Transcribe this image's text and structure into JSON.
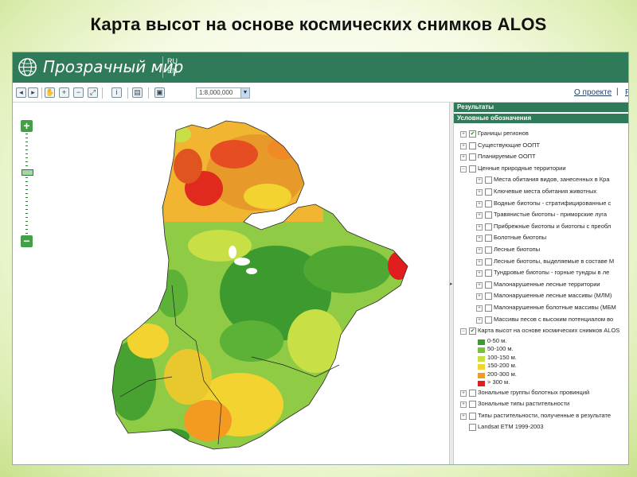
{
  "slide_title": "Карта высот на основе космических снимков ALOS",
  "header": {
    "logo_text": "Прозрачный мир",
    "lang_ru": "RU",
    "lang_en": "EN"
  },
  "toolbar": {
    "scale_value": "1:8,000,000",
    "about_link": "О проекте",
    "separator": "|",
    "truncated_link": "Р",
    "icons": [
      "back-icon",
      "forward-icon",
      "pan-icon",
      "zoom-in-icon",
      "zoom-out-icon",
      "zoom-extent-icon",
      "info-icon",
      "print-icon",
      "save-icon"
    ]
  },
  "map": {
    "zoom_in": "+",
    "zoom_out": "−"
  },
  "panel": {
    "results_title": "Результаты",
    "legend_title": "Условные обозначения",
    "layers": [
      {
        "label": "Границы регионов",
        "level": 0,
        "checked": true
      },
      {
        "label": "Существующие ООПТ",
        "level": 0,
        "checked": false
      },
      {
        "label": "Планируемые ООПТ",
        "level": 0,
        "checked": false
      },
      {
        "label": "Ценные природные территории",
        "level": 0,
        "checked": false,
        "expanded": true
      },
      {
        "label": "Места обитания видов, занесенных в Кра",
        "level": 1,
        "checked": false
      },
      {
        "label": "Ключевые места обитания животных",
        "level": 1,
        "checked": false
      },
      {
        "label": "Водные биотопы - стратифицированные с",
        "level": 1,
        "checked": false
      },
      {
        "label": "Травянистые биотопы - приморские луга",
        "level": 1,
        "checked": false
      },
      {
        "label": "Прибрежные биотопы и биотопы с преобл",
        "level": 1,
        "checked": false
      },
      {
        "label": "Болотные биотопы",
        "level": 1,
        "checked": false
      },
      {
        "label": "Лесные биотопы",
        "level": 1,
        "checked": false
      },
      {
        "label": "Лесные биотопы, выделяемые в составе М",
        "level": 1,
        "checked": false
      },
      {
        "label": "Тундровые биотопы - горные тундры в ле",
        "level": 1,
        "checked": false
      },
      {
        "label": "Малонарушенные лесные территории",
        "level": 1,
        "checked": false
      },
      {
        "label": "Малонарушенные лесные массивы (МЛМ)",
        "level": 1,
        "checked": false
      },
      {
        "label": "Малонарушенные болотные массивы (МБМ",
        "level": 1,
        "checked": false
      },
      {
        "label": "Массивы песов с высоким потенциалом во",
        "level": 1,
        "checked": false
      },
      {
        "label": "Карта высот на основе космических снимков ALOS",
        "level": 0,
        "checked": true,
        "expanded": true
      }
    ],
    "elevation_legend": [
      {
        "label": "0-50 м.",
        "color": "#3c9a2e"
      },
      {
        "label": "50-100 м.",
        "color": "#7cc13a"
      },
      {
        "label": "100-150 м.",
        "color": "#c8e046"
      },
      {
        "label": "150-200 м.",
        "color": "#f3d330"
      },
      {
        "label": "200-300 м.",
        "color": "#f29a22"
      },
      {
        "label": "> 300 м.",
        "color": "#e01e1e"
      }
    ],
    "layers_after": [
      {
        "label": "Зональные группы болотных провинций",
        "level": 0,
        "checked": false
      },
      {
        "label": "Зональные типы растительности",
        "level": 0,
        "checked": false
      },
      {
        "label": "Типы растительности, полученные в результате",
        "level": 0,
        "checked": false
      },
      {
        "label": "Landsat ETM 1999-2003",
        "level": 0,
        "checked": false,
        "no_toggle": true
      }
    ]
  }
}
